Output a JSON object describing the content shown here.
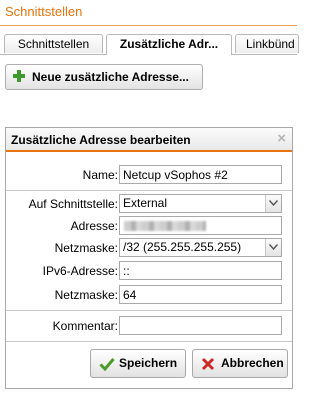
{
  "page_title": "Schnittstellen",
  "tabs": [
    {
      "label": "Schnittstellen",
      "active": false
    },
    {
      "label": "Zusätzliche Adr...",
      "active": true
    },
    {
      "label": "Linkbünd",
      "active": false
    }
  ],
  "new_button": {
    "label": "Neue zusätzliche Adresse...",
    "icon": "plus-icon"
  },
  "dialog": {
    "title": "Zusätzliche Adresse bearbeiten",
    "close_icon": "×",
    "fields": {
      "name": {
        "label": "Name:",
        "value": "Netcup vSophos #2"
      },
      "interface": {
        "label": "Auf Schnittstelle:",
        "value": "External"
      },
      "address": {
        "label": "Adresse:",
        "value": "",
        "redacted": true
      },
      "netmask": {
        "label": "Netzmaske:",
        "value": "/32 (255.255.255.255)"
      },
      "ipv6": {
        "label": "IPv6-Adresse:",
        "value": "::"
      },
      "netmask6": {
        "label": "Netzmaske:",
        "value": "64"
      },
      "comment": {
        "label": "Kommentar:",
        "value": ""
      }
    },
    "save_button": {
      "label": "Speichern",
      "icon": "check-icon",
      "color": "#4a9a2c"
    },
    "cancel_button": {
      "label": "Abbrechen",
      "icon": "cross-icon",
      "color": "#cc2a2a"
    }
  },
  "colors": {
    "accent": "#e8730f"
  }
}
